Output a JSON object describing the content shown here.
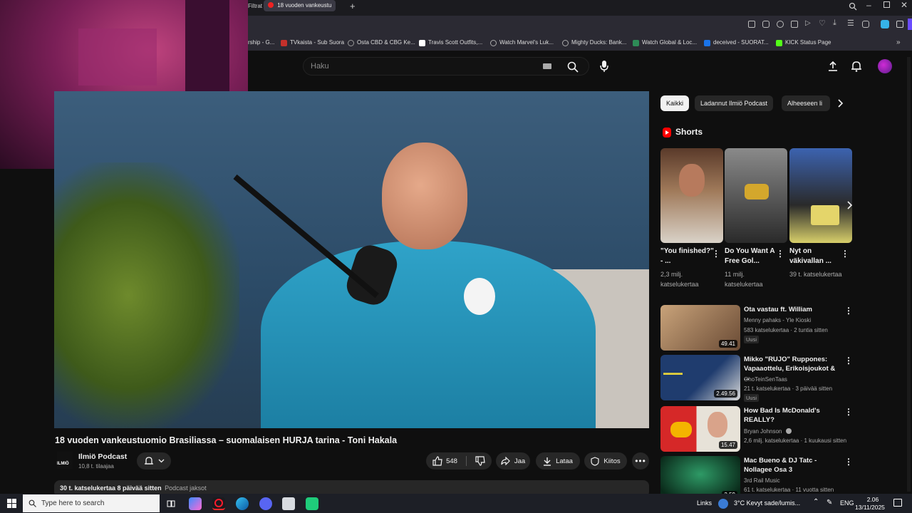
{
  "browser": {
    "tabs": {
      "prev_tab": "Filtrat",
      "active_tab": "18 vuoden vankeustu"
    },
    "bookmarks": [
      {
        "label": "rship - G...",
        "color": "#555"
      },
      {
        "label": "TVkaista - Sub Suora",
        "color": "#c4302b"
      },
      {
        "label": "Osta CBD & CBG Ke...",
        "color": "#777"
      },
      {
        "label": "Travis Scott Outfits,...",
        "color": "#fff"
      },
      {
        "label": "Watch Marvel's Luk...",
        "color": "#aaa"
      },
      {
        "label": "Mighty Ducks: Bank...",
        "color": "#aaa"
      },
      {
        "label": "Watch Global & Loc...",
        "color": "#2e8b57"
      },
      {
        "label": "deceived - SUORAT...",
        "color": "#1a73e8"
      },
      {
        "label": "KICK Status Page",
        "color": "#53fc18"
      }
    ]
  },
  "youtube": {
    "search_placeholder": "Haku"
  },
  "video": {
    "title": "18 vuoden vankeustuomio Brasiliassa – suomalaisen HURJA tarina - Toni Hakala",
    "channel_name": "Ilmiö Podcast",
    "channel_logo_text": "ILMIÖ",
    "subscribers": "10,8 t. tilaajaa",
    "likes": "548",
    "share_label": "Jaa",
    "download_label": "Lataa",
    "thanks_label": "Kiitos",
    "views_age": "30 t. katselukertaa  8 päivää sitten",
    "playlist": "Podcast jaksot"
  },
  "sidebar": {
    "chips": [
      {
        "label": "Kaikki",
        "active": true
      },
      {
        "label": "Ladannut Ilmiö Podcast",
        "active": false
      },
      {
        "label": "Alheeseen li",
        "active": false
      }
    ],
    "shorts_heading": "Shorts",
    "shorts": [
      {
        "title": "\"You finished?\" - ...",
        "views": "2,3 milj. katselukertaa"
      },
      {
        "title": "Do You Want A Free Gol...",
        "views": "11 milj. katselukertaa"
      },
      {
        "title": "Nyt on väkivallan ...",
        "views": "39 t. katselukertaa"
      }
    ],
    "recommendations": [
      {
        "title": "Ota vastau ft. William",
        "channel": "Menny pahaks - Yle Kioski",
        "meta": "583 katselukertaa · 2 tuntia sitten",
        "badge": "Uusi",
        "duration": "49.41",
        "colors": [
          "#c9a37a",
          "#6a4b35"
        ]
      },
      {
        "title": "Mikko \"RUJO\" Ruppones: Vapaaottelu, Erikoisjoukot & ...",
        "channel": "OhoTeinSenTaas",
        "meta": "21 t. katselukertaa · 3 päivää sitten",
        "badge": "Uusi",
        "duration": "2.49.56",
        "colors": [
          "#1f3c6e",
          "#e8d43a"
        ]
      },
      {
        "title": "How Bad Is McDonald's REALLY?",
        "channel": "Bryan Johnson",
        "meta": "2,6 milj. katselukertaa · 1 kuukausi sitten",
        "badge": "",
        "duration": "15.47",
        "colors": [
          "#d62828",
          "#f4b400"
        ]
      },
      {
        "title": "Mac Bueno & DJ Tatc - Nollagee Osa 3",
        "channel": "3rd Rail Music",
        "meta": "61 t. katselukertaa · 11 vuotta sitten",
        "badge": "",
        "duration": "3.59",
        "colors": [
          "#1b5e3a",
          "#0a2a1a"
        ]
      }
    ]
  },
  "taskbar": {
    "search_placeholder": "Type here to search",
    "links_label": "Links",
    "weather": "3°C  Kevyt sade/lumis...",
    "language": "ENG",
    "time": "2.06",
    "date": "13/11/2025"
  },
  "colors": {
    "youtube_red": "#ff0000",
    "background": "#0f0f0f",
    "chip_bg": "#272727"
  }
}
